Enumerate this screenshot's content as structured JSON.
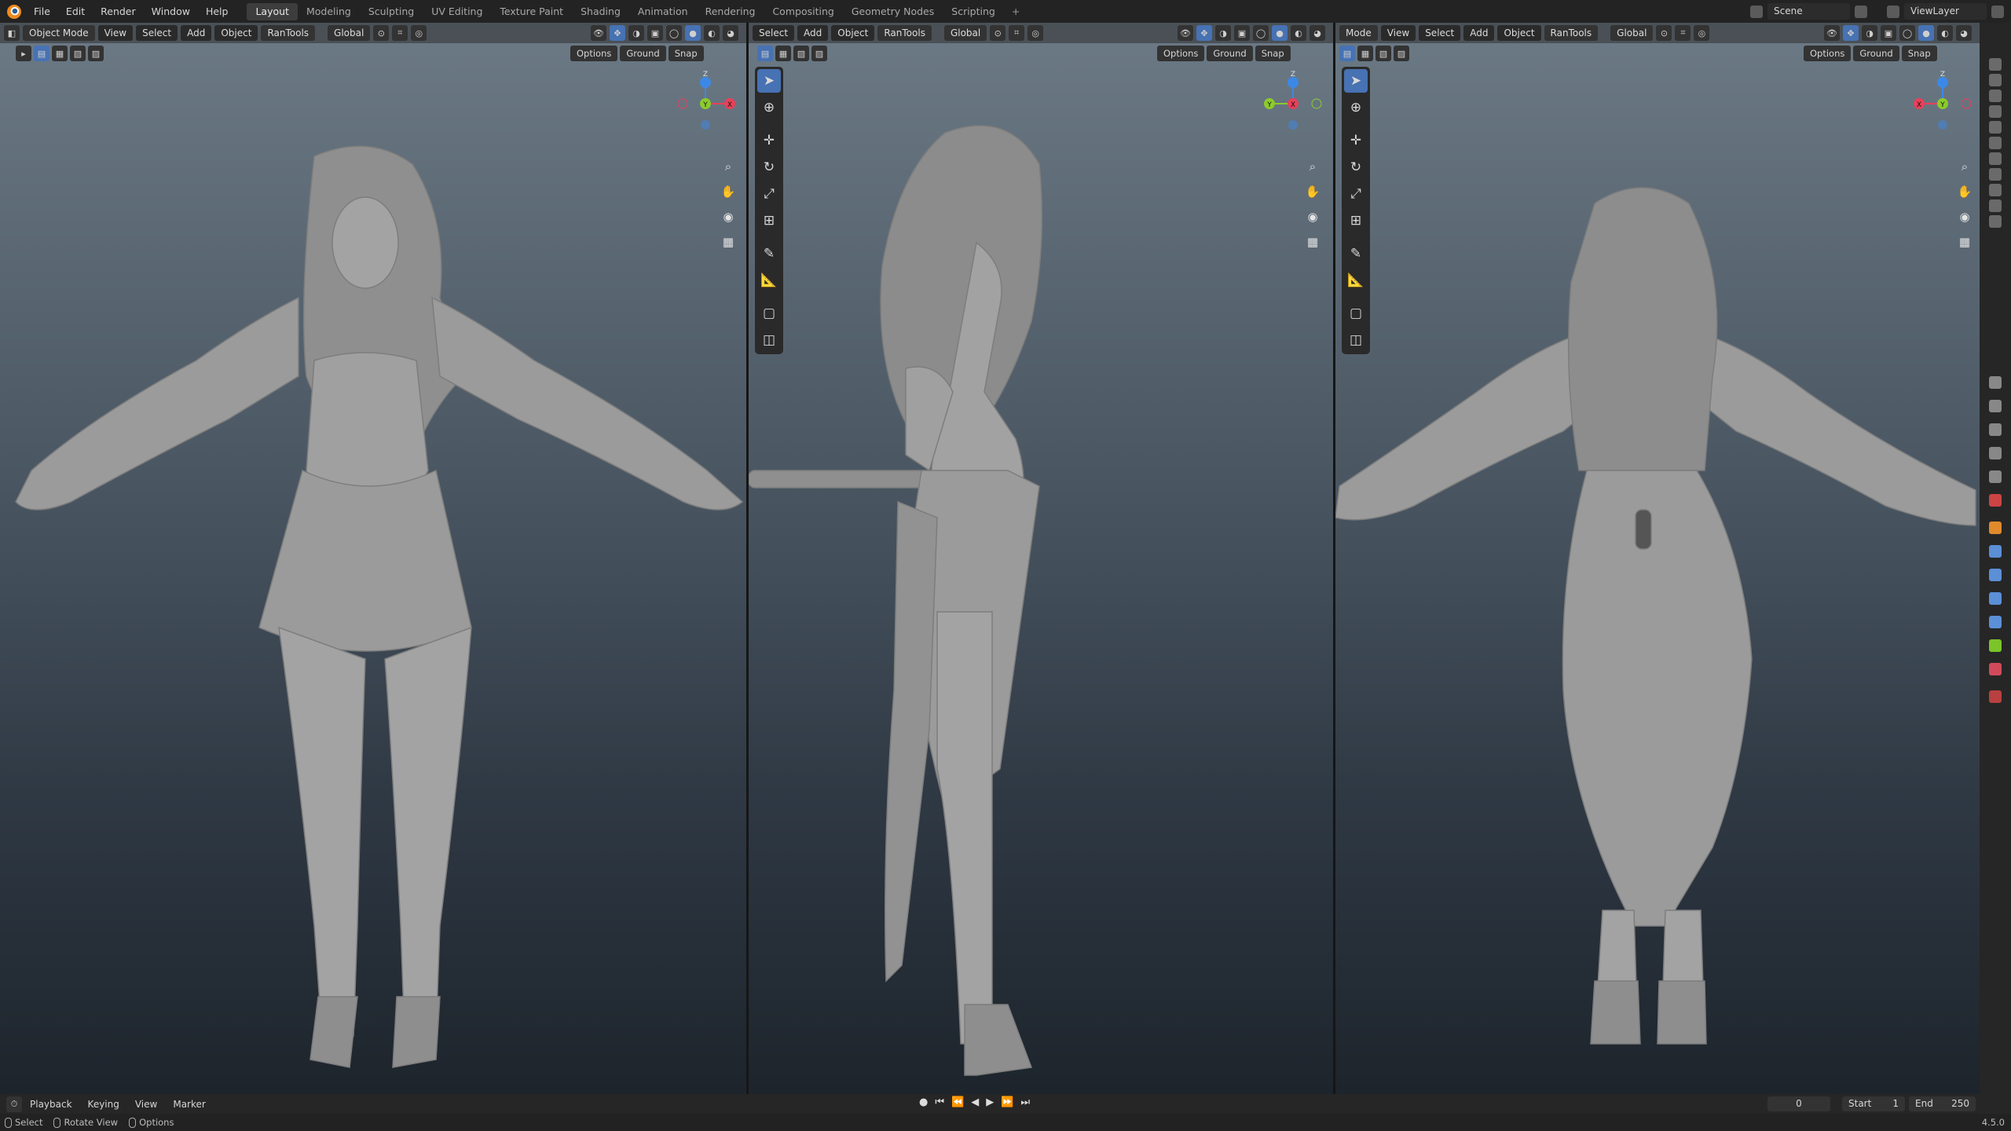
{
  "menus": [
    "File",
    "Edit",
    "Render",
    "Window",
    "Help"
  ],
  "workspaces": [
    "Layout",
    "Modeling",
    "Sculpting",
    "UV Editing",
    "Texture Paint",
    "Shading",
    "Animation",
    "Rendering",
    "Compositing",
    "Geometry Nodes",
    "Scripting"
  ],
  "active_workspace": "Layout",
  "add_workspace": "+",
  "scene": "Scene",
  "view_layer": "ViewLayer",
  "viewport_left": {
    "mode": "Object Mode",
    "menus": [
      "View",
      "Select",
      "Add",
      "Object"
    ],
    "rantools": "RanTools",
    "orientation": "Global",
    "options": "Options",
    "ground": "Ground",
    "snap": "Snap",
    "gizmo": {
      "x": "X",
      "y": "Y",
      "z": "Z"
    }
  },
  "viewport_center": {
    "menus": [
      "Select",
      "Add",
      "Object"
    ],
    "rantools": "RanTools",
    "orientation": "Global",
    "options": "Options",
    "ground": "Ground",
    "snap": "Snap",
    "gizmo": {
      "x": "X",
      "y": "Y",
      "z": "Z"
    }
  },
  "viewport_right": {
    "mode": "Mode",
    "menus": [
      "View",
      "Select",
      "Add",
      "Object"
    ],
    "rantools": "RanTools",
    "orientation": "Global",
    "options": "Options",
    "ground": "Ground",
    "snap": "Snap",
    "gizmo": {
      "x": "X",
      "y": "Y",
      "z": "Z"
    }
  },
  "timeline": {
    "menus": [
      "Playback",
      "Keying",
      "View",
      "Marker"
    ],
    "current_frame": "0",
    "start_label": "Start",
    "start": "1",
    "end_label": "End",
    "end": "250"
  },
  "status": {
    "select": "Select",
    "rotate": "Rotate View",
    "options": "Options",
    "version": "4.5.0"
  },
  "colors": {
    "accent": "#4772b3",
    "axis_x": "#e8405a",
    "axis_y": "#8bcb2c",
    "axis_z": "#3c88e6",
    "model": "#9a9a9a"
  }
}
